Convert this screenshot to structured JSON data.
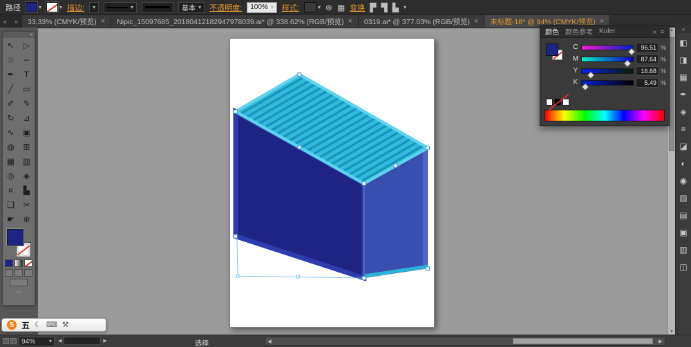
{
  "window": {
    "object_status_label": "路径"
  },
  "icons": {
    "caret_down": "▾",
    "close": "×",
    "collapse_left": "«",
    "expand_right": "»",
    "menu": "≡",
    "left_arrow": "◀",
    "right_arrow": "▶",
    "up_arrow": "▲",
    "down_arrow": "▼",
    "ellipsis": "⋯",
    "recolor": "⊛",
    "grid": "▦",
    "align_a": "▛",
    "align_b": "▜",
    "align_c": "▙",
    "moon": "☾",
    "keyboard": "⌨",
    "wrench": "⚒"
  },
  "control_bar": {
    "stroke_label": "描边:",
    "brush_name": "基本",
    "opacity_label": "不透明度:",
    "opacity_value": "100%",
    "style_label": "样式:",
    "transform_label": "变换"
  },
  "tabs": [
    {
      "label": "33.33% (CMYK/预览)",
      "active": false
    },
    {
      "label": "Nipic_15097685_20180412182947978039.ai* @ 338.62% (RGB/预览)",
      "active": false
    },
    {
      "label": "0319.ai* @ 377.03% (RGB/预览)",
      "active": false
    },
    {
      "label": "未标题-18* @ 94% (CMYK/预览)",
      "active": true
    }
  ],
  "toolbar": {
    "tools": [
      {
        "name": "selection-tool",
        "glyph": "↖"
      },
      {
        "name": "direct-selection-tool",
        "glyph": "▷"
      },
      {
        "name": "magic-wand-tool",
        "glyph": "☆"
      },
      {
        "name": "lasso-tool",
        "glyph": "∽"
      },
      {
        "name": "pen-tool",
        "glyph": "✒"
      },
      {
        "name": "type-tool",
        "glyph": "T"
      },
      {
        "name": "line-segment-tool",
        "glyph": "╱"
      },
      {
        "name": "rectangle-tool",
        "glyph": "▭"
      },
      {
        "name": "paintbrush-tool",
        "glyph": "✐"
      },
      {
        "name": "pencil-tool",
        "glyph": "✎"
      },
      {
        "name": "rotate-tool",
        "glyph": "↻"
      },
      {
        "name": "scale-tool",
        "glyph": "⊿"
      },
      {
        "name": "width-tool",
        "glyph": "∿"
      },
      {
        "name": "free-transform-tool",
        "glyph": "▣"
      },
      {
        "name": "shape-builder-tool",
        "glyph": "◍"
      },
      {
        "name": "perspective-grid-tool",
        "glyph": "⊞"
      },
      {
        "name": "mesh-tool",
        "glyph": "▦"
      },
      {
        "name": "gradient-tool",
        "glyph": "▥"
      },
      {
        "name": "eyedropper-tool",
        "glyph": "◎"
      },
      {
        "name": "blend-tool",
        "glyph": "◈"
      },
      {
        "name": "symbol-sprayer-tool",
        "glyph": "¤"
      },
      {
        "name": "column-graph-tool",
        "glyph": "▙"
      },
      {
        "name": "artboard-tool",
        "glyph": "❏"
      },
      {
        "name": "slice-tool",
        "glyph": "✂"
      },
      {
        "name": "hand-tool",
        "glyph": "☛"
      },
      {
        "name": "zoom-tool",
        "glyph": "⊕"
      }
    ]
  },
  "artwork": {
    "description": "isometric container with striped cyan top, navy front and indigo side, selected with handles",
    "colors": {
      "top": "#2fb9da",
      "top_stripe": "#1693b8",
      "top_edge": "#5ed3ec",
      "front": "#1e2483",
      "front_frame": "#2d3cae",
      "side": "#3a4eb0",
      "side_edge": "#4e66c8",
      "side_bottom_edge": "#2ab5d8",
      "selection": "#7fc4e8",
      "handle_border": "#3f95d4"
    }
  },
  "color_panel": {
    "tabs": [
      {
        "label": "颜色",
        "active": true
      },
      {
        "label": "颜色参考",
        "active": false
      },
      {
        "label": "Kuler",
        "active": false
      }
    ],
    "sliders": [
      {
        "channel": "C",
        "value": "96.51"
      },
      {
        "channel": "M",
        "value": "87.64"
      },
      {
        "channel": "Y",
        "value": "16.68"
      },
      {
        "channel": "K",
        "value": "5.49"
      }
    ],
    "unit": "%"
  },
  "dock": {
    "panels": [
      {
        "name": "color-panel-icon",
        "glyph": "◧"
      },
      {
        "name": "color-guide-panel-icon",
        "glyph": "◨"
      },
      {
        "name": "swatches-panel-icon",
        "glyph": "▦"
      },
      {
        "name": "brushes-panel-icon",
        "glyph": "✒"
      },
      {
        "name": "symbols-panel-icon",
        "glyph": "◈"
      },
      {
        "name": "stroke-panel-icon",
        "glyph": "≡"
      },
      {
        "name": "gradient-panel-icon",
        "glyph": "◪"
      },
      {
        "name": "transparency-panel-icon",
        "glyph": "◐"
      },
      {
        "name": "appearance-panel-icon",
        "glyph": "◉"
      },
      {
        "name": "graphic-styles-panel-icon",
        "glyph": "▨"
      },
      {
        "name": "layers-panel-icon",
        "glyph": "▤"
      },
      {
        "name": "artboards-panel-icon",
        "glyph": "▣"
      },
      {
        "name": "align-panel-icon",
        "glyph": "▥"
      },
      {
        "name": "pathfinder-panel-icon",
        "glyph": "◫"
      }
    ]
  },
  "status_bar": {
    "zoom": "94%",
    "tool_status": "选择"
  },
  "ime": {
    "logo_letter": "S",
    "mode_label": "五"
  }
}
